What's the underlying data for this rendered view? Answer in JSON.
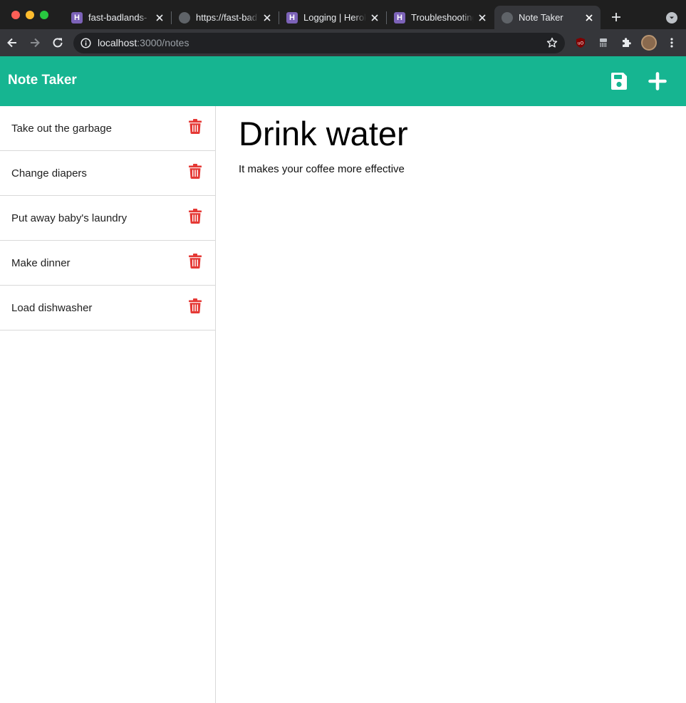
{
  "browser": {
    "tabs": [
      {
        "title": "fast-badlands-",
        "favicon": "heroku-icon"
      },
      {
        "title": "https://fast-bad",
        "favicon": "globe-icon"
      },
      {
        "title": "Logging | Herok",
        "favicon": "heroku-icon"
      },
      {
        "title": "Troubleshooting",
        "favicon": "heroku-icon"
      },
      {
        "title": "Note Taker",
        "favicon": "globe-icon",
        "active": true
      }
    ],
    "url_host": "localhost",
    "url_rest": ":3000/notes"
  },
  "app": {
    "brand": "Note Taker",
    "accent_color": "#16b591",
    "delete_color": "#e53935",
    "notes": [
      {
        "title": "Take out the garbage"
      },
      {
        "title": "Change diapers"
      },
      {
        "title": "Put away baby's laundry"
      },
      {
        "title": "Make dinner"
      },
      {
        "title": "Load dishwasher"
      }
    ],
    "active_note": {
      "title": "Drink water",
      "text": "It makes your coffee more effective"
    }
  }
}
